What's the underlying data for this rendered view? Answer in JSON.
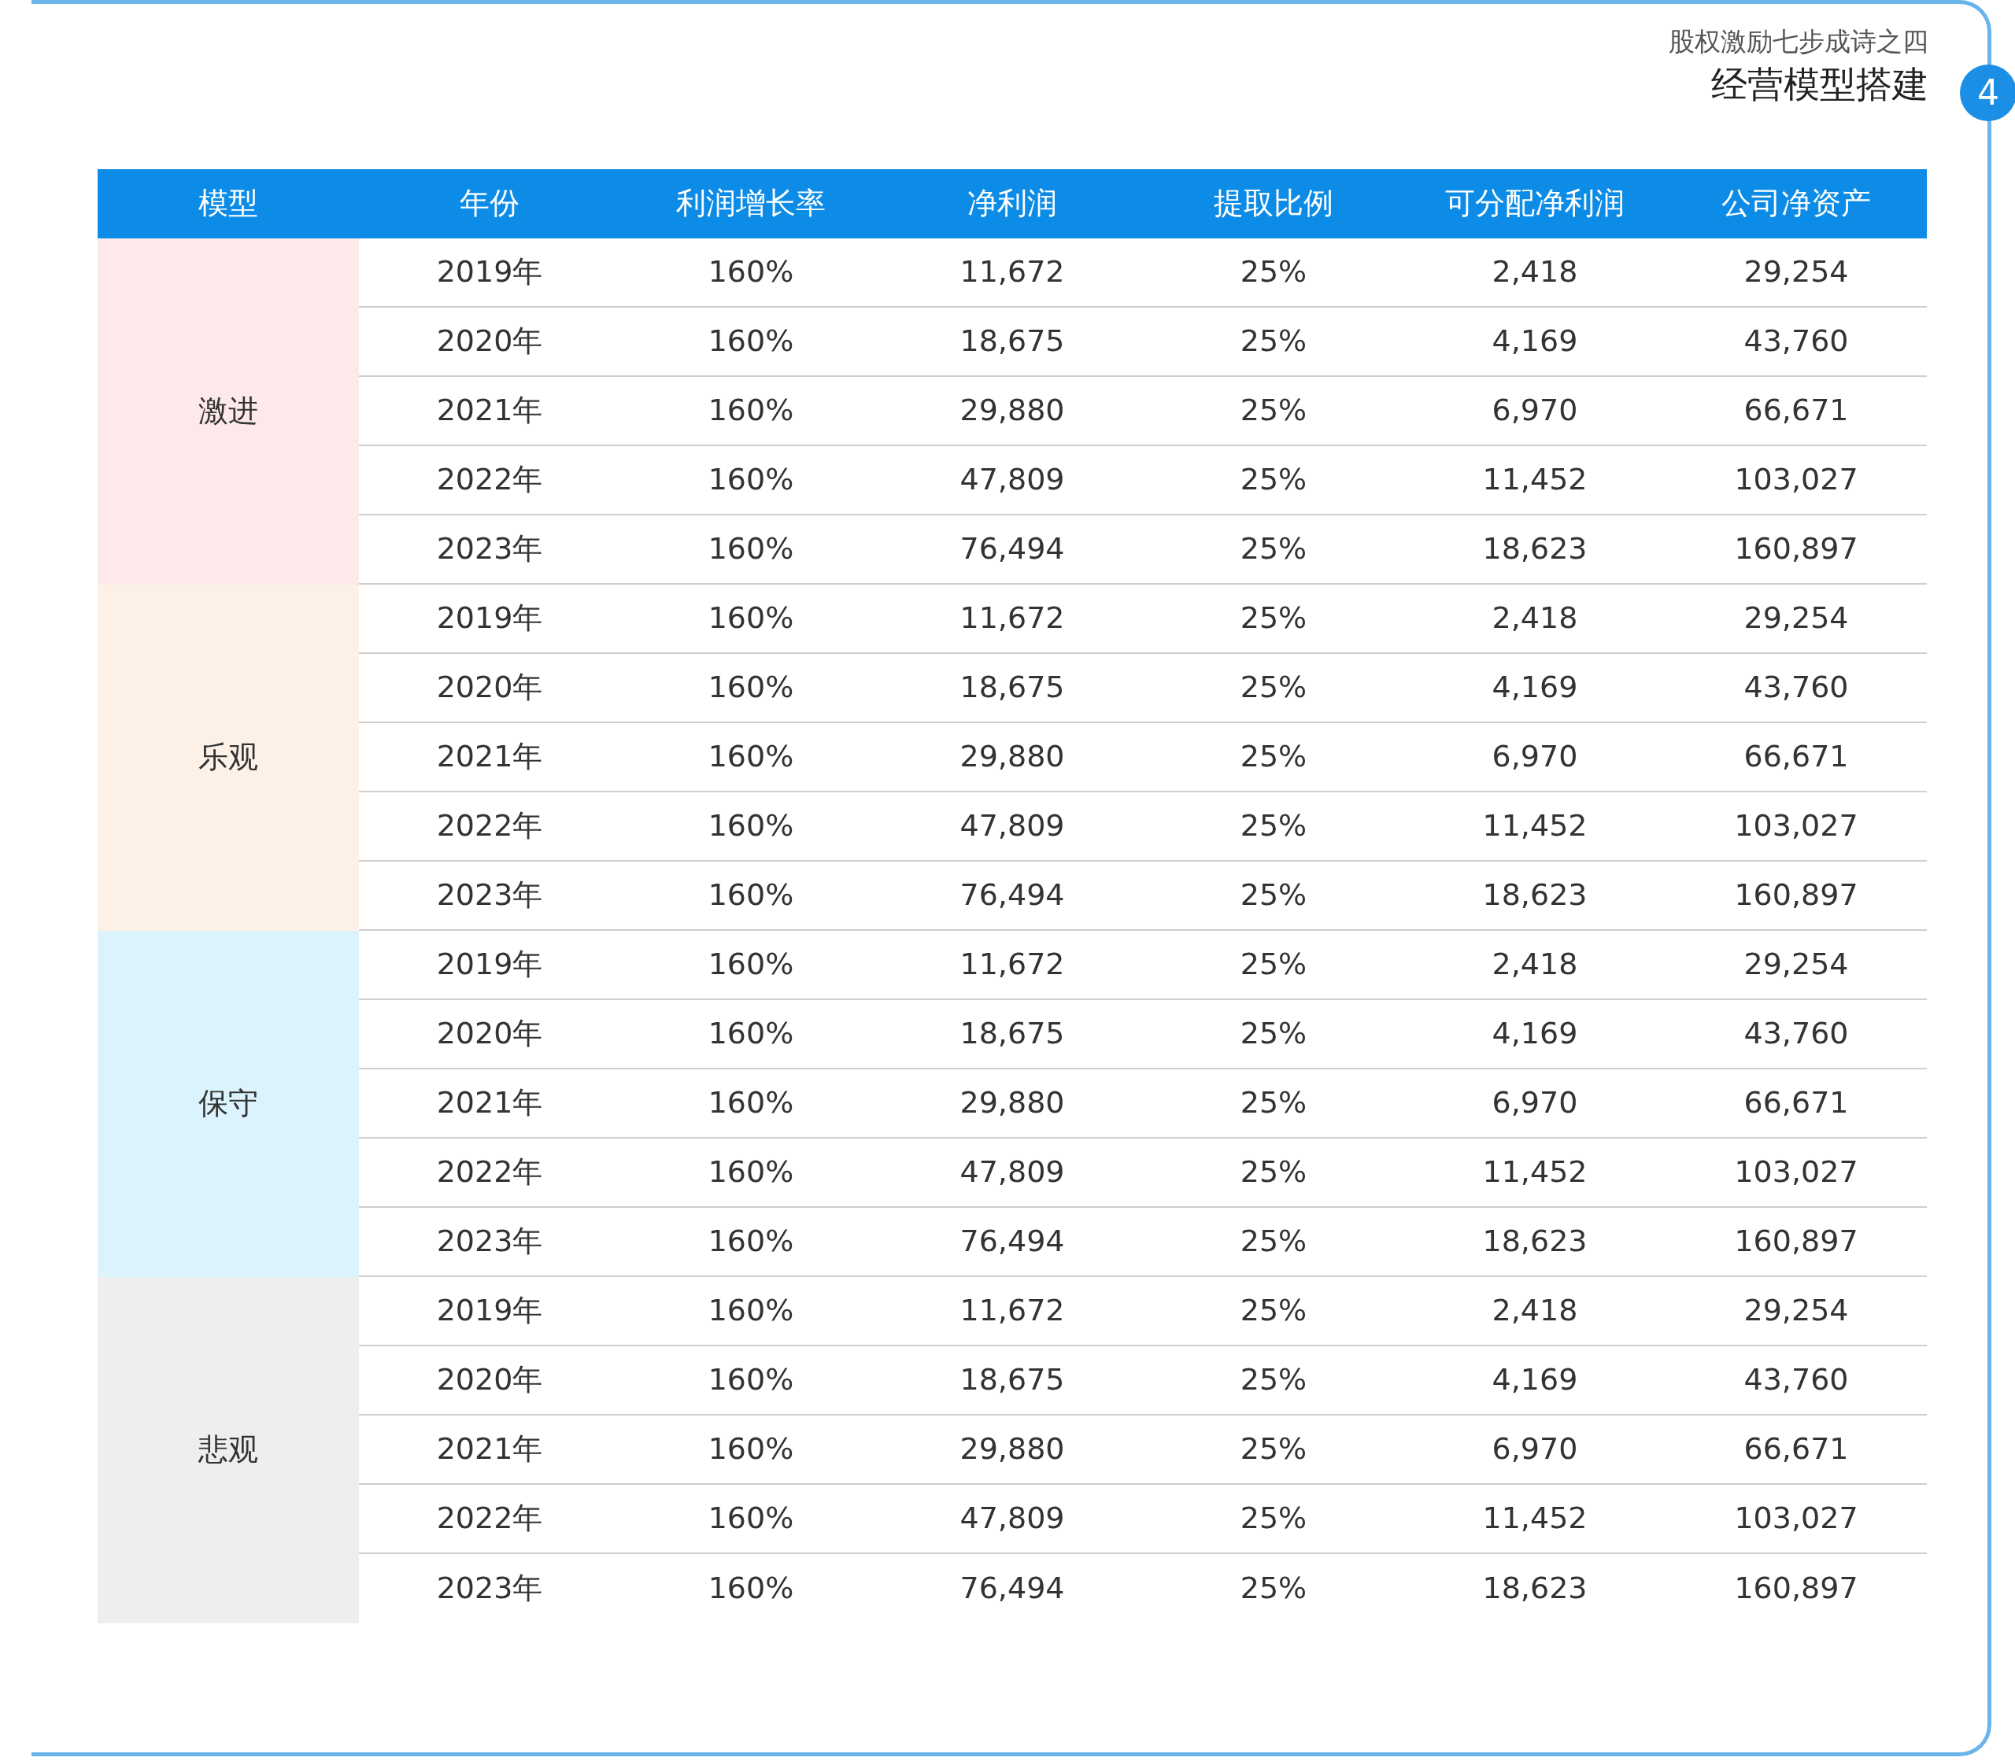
{
  "header": {
    "subtitle": "股权激励七步成诗之四",
    "title": "经营模型搭建",
    "badge": "4"
  },
  "table": {
    "columns": [
      "模型",
      "年份",
      "利润增长率",
      "净利润",
      "提取比例",
      "可分配净利润",
      "公司净资产"
    ],
    "groups": [
      {
        "name": "激进",
        "color": "#fde8ea",
        "rows": [
          [
            "2019年",
            "160%",
            "11,672",
            "25%",
            "2,418",
            "29,254"
          ],
          [
            "2020年",
            "160%",
            "18,675",
            "25%",
            "4,169",
            "43,760"
          ],
          [
            "2021年",
            "160%",
            "29,880",
            "25%",
            "6,970",
            "66,671"
          ],
          [
            "2022年",
            "160%",
            "47,809",
            "25%",
            "11,452",
            "103,027"
          ],
          [
            "2023年",
            "160%",
            "76,494",
            "25%",
            "18,623",
            "160,897"
          ]
        ]
      },
      {
        "name": "乐观",
        "color": "#fdf0e7",
        "rows": [
          [
            "2019年",
            "160%",
            "11,672",
            "25%",
            "2,418",
            "29,254"
          ],
          [
            "2020年",
            "160%",
            "18,675",
            "25%",
            "4,169",
            "43,760"
          ],
          [
            "2021年",
            "160%",
            "29,880",
            "25%",
            "6,970",
            "66,671"
          ],
          [
            "2022年",
            "160%",
            "47,809",
            "25%",
            "11,452",
            "103,027"
          ],
          [
            "2023年",
            "160%",
            "76,494",
            "25%",
            "18,623",
            "160,897"
          ]
        ]
      },
      {
        "name": "保守",
        "color": "#dbf3fc",
        "rows": [
          [
            "2019年",
            "160%",
            "11,672",
            "25%",
            "2,418",
            "29,254"
          ],
          [
            "2020年",
            "160%",
            "18,675",
            "25%",
            "4,169",
            "43,760"
          ],
          [
            "2021年",
            "160%",
            "29,880",
            "25%",
            "6,970",
            "66,671"
          ],
          [
            "2022年",
            "160%",
            "47,809",
            "25%",
            "11,452",
            "103,027"
          ],
          [
            "2023年",
            "160%",
            "76,494",
            "25%",
            "18,623",
            "160,897"
          ]
        ]
      },
      {
        "name": "悲观",
        "color": "#eeeeee",
        "rows": [
          [
            "2019年",
            "160%",
            "11,672",
            "25%",
            "2,418",
            "29,254"
          ],
          [
            "2020年",
            "160%",
            "18,675",
            "25%",
            "4,169",
            "43,760"
          ],
          [
            "2021年",
            "160%",
            "29,880",
            "25%",
            "6,970",
            "66,671"
          ],
          [
            "2022年",
            "160%",
            "47,809",
            "25%",
            "11,452",
            "103,027"
          ],
          [
            "2023年",
            "160%",
            "76,494",
            "25%",
            "18,623",
            "160,897"
          ]
        ]
      }
    ]
  }
}
